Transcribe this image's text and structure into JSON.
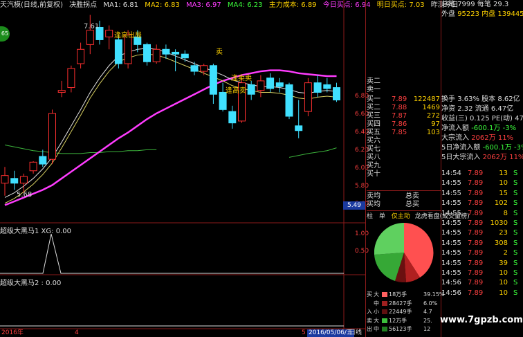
{
  "header": {
    "stock_name": "天汽模(日线,前复权)",
    "indicator": "决胜拐点",
    "ma1": "MA1: 6.81",
    "ma2": "MA2: 6.83",
    "ma3": "MA3: 6.97",
    "ma4": "MA4: 6.23",
    "cost": "主力成本: 6.89",
    "buy_today": "今日买点: 6.94",
    "buy_tomorrow": "明日买点: 7.03",
    "rest": "昨测今日"
  },
  "annotations": {
    "peak": "7.61",
    "low": "5.68",
    "exit1": "逢高出局",
    "sell1": "卖",
    "sell2": "逢高卖",
    "sell3": "逢卖卖",
    "small": "卖"
  },
  "price_axis": [
    "6.80",
    "6.60",
    "6.40",
    "6.20",
    "6.00",
    "5.80",
    "5.60"
  ],
  "current_price": "5.49",
  "sub1": {
    "title": "超级大黑马1 XG: 0.00",
    "axis": [
      "1.00",
      "0.50"
    ]
  },
  "sub2": {
    "title": "超级大黑马2 : 0.00"
  },
  "bottom": {
    "left": "2016年",
    "mid": "4",
    "mid2": "5",
    "date": "2016/05/06/五",
    "period": "日线"
  },
  "orderbook": {
    "asks": [
      {
        "label": "卖二",
        "price": "",
        "vol": ""
      },
      {
        "label": "卖一",
        "price": "",
        "vol": ""
      }
    ],
    "bids": [
      {
        "label": "买一",
        "price": "7.89",
        "vol": "122487"
      },
      {
        "label": "买二",
        "price": "7.88",
        "vol": "1469"
      },
      {
        "label": "买三",
        "price": "7.87",
        "vol": "272"
      },
      {
        "label": "买四",
        "price": "7.86",
        "vol": "97"
      },
      {
        "label": "买五",
        "price": "7.85",
        "vol": "103"
      },
      {
        "label": "买六",
        "price": "",
        "vol": ""
      },
      {
        "label": "买七",
        "price": "",
        "vol": ""
      },
      {
        "label": "买八",
        "price": "",
        "vol": ""
      },
      {
        "label": "买九",
        "price": "",
        "vol": ""
      },
      {
        "label": "买十",
        "price": "",
        "vol": ""
      }
    ],
    "avg_sell": "卖均",
    "total_sell": "总卖",
    "avg_buy": "买均",
    "total_buy": "总买"
  },
  "stats": [
    {
      "k": "总笔",
      "v": "7999 每笔",
      "v2": "29.3",
      "color": "#ddd"
    },
    {
      "k": "外盘",
      "v": "95223 内盘",
      "v2": "139445",
      "color": "#ffd200"
    },
    {
      "k": "换手",
      "v": "3.63% 股本",
      "v2": "8.62亿",
      "color": "#ddd"
    },
    {
      "k": "净资",
      "v": "2.32 流通",
      "v2": "6.47亿",
      "color": "#ddd"
    },
    {
      "k": "收益(三)",
      "v": "0.125 PE(动)",
      "v2": "47.4",
      "color": "#ddd"
    },
    {
      "k": "净流入额",
      "v": "-600.1万",
      "v2": "-3%",
      "color": "#3cff3c"
    },
    {
      "k": "大宗流入",
      "v": "2062万",
      "v2": "11%",
      "color": "#ff4040"
    },
    {
      "k": "5日净流入额",
      "v": "-600.1万",
      "v2": "-3%",
      "color": "#3cff3c"
    },
    {
      "k": "5日大宗流入",
      "v": "2062万",
      "v2": "11%",
      "color": "#ff4040"
    }
  ],
  "ticks": [
    {
      "t": "14:54",
      "p": "7.89",
      "v": "13",
      "s": "S"
    },
    {
      "t": "14:55",
      "p": "7.89",
      "v": "10",
      "s": "S"
    },
    {
      "t": "14:55",
      "p": "7.89",
      "v": "15",
      "s": "S"
    },
    {
      "t": "14:55",
      "p": "7.89",
      "v": "102",
      "s": "S"
    },
    {
      "t": "14:55",
      "p": "7.89",
      "v": "8",
      "s": "S"
    },
    {
      "t": "14:55",
      "p": "7.89",
      "v": "1030",
      "s": "S"
    },
    {
      "t": "14:55",
      "p": "7.89",
      "v": "23",
      "s": "S"
    },
    {
      "t": "14:55",
      "p": "7.89",
      "v": "308",
      "s": "S"
    },
    {
      "t": "14:55",
      "p": "7.89",
      "v": "2",
      "s": "S"
    },
    {
      "t": "14:55",
      "p": "7.89",
      "v": "39",
      "s": "S"
    },
    {
      "t": "14:55",
      "p": "7.89",
      "v": "10",
      "s": "S"
    },
    {
      "t": "14:56",
      "p": "7.89",
      "v": "10",
      "s": "S"
    },
    {
      "t": "14:56",
      "p": "7.89",
      "v": "10",
      "s": "S"
    }
  ],
  "tabs": [
    "柱",
    "单",
    "仅主动",
    "龙虎看盘(成交量榜)"
  ],
  "dist": [
    {
      "side": "买",
      "k": "大",
      "v": "18万手",
      "pct": "39.15%",
      "color": "#ff6060"
    },
    {
      "side": "",
      "k": "中",
      "v": "28427手",
      "pct": "6.0%",
      "color": "#a02020"
    },
    {
      "side": "入",
      "k": "小",
      "v": "22449手",
      "pct": "4.7",
      "color": "#601010"
    },
    {
      "side": "卖",
      "k": "大",
      "v": "12万手",
      "pct": "25.",
      "color": "#3cbf3c"
    },
    {
      "side": "出",
      "k": "中",
      "v": "56123手",
      "pct": "12",
      "color": "#208020"
    }
  ],
  "watermark": "www.7gpzb.com",
  "logo": "65",
  "colors": {
    "up": "#ff3030",
    "down": "#40e0ff",
    "ma_slow": "#ff3cff",
    "ma_mid": "#3cb43c",
    "ma_fast": "#e0e0e0",
    "ma_yellow": "#d8d060"
  },
  "chart_data": {
    "type": "candlestick",
    "candles": [
      {
        "o": 5.85,
        "h": 6.02,
        "l": 5.72,
        "c": 5.93
      },
      {
        "o": 5.9,
        "h": 5.98,
        "l": 5.78,
        "c": 5.85
      },
      {
        "o": 5.85,
        "h": 5.95,
        "l": 5.75,
        "c": 5.92
      },
      {
        "o": 5.98,
        "h": 6.08,
        "l": 5.95,
        "c": 6.07
      },
      {
        "o": 6.13,
        "h": 6.2,
        "l": 6.02,
        "c": 6.05
      },
      {
        "o": 6.1,
        "h": 6.62,
        "l": 6.05,
        "c": 6.58
      },
      {
        "o": 6.8,
        "h": 6.92,
        "l": 6.75,
        "c": 6.82
      },
      {
        "o": 6.85,
        "h": 7.08,
        "l": 6.8,
        "c": 7.05
      },
      {
        "o": 7.1,
        "h": 7.32,
        "l": 7.05,
        "c": 7.25
      },
      {
        "o": 7.3,
        "h": 7.61,
        "l": 7.2,
        "c": 7.45
      },
      {
        "o": 7.48,
        "h": 7.55,
        "l": 7.3,
        "c": 7.35
      },
      {
        "o": 7.38,
        "h": 7.5,
        "l": 7.25,
        "c": 7.45
      },
      {
        "o": 7.35,
        "h": 7.4,
        "l": 7.05,
        "c": 7.1
      },
      {
        "o": 7.1,
        "h": 7.45,
        "l": 7.05,
        "c": 7.4
      },
      {
        "o": 7.38,
        "h": 7.45,
        "l": 7.22,
        "c": 7.3
      },
      {
        "o": 7.3,
        "h": 7.32,
        "l": 7.08,
        "c": 7.12
      },
      {
        "o": 7.12,
        "h": 7.3,
        "l": 7.1,
        "c": 7.25
      },
      {
        "o": 7.25,
        "h": 7.3,
        "l": 7.15,
        "c": 7.2
      },
      {
        "o": 7.22,
        "h": 7.25,
        "l": 7.02,
        "c": 7.2
      },
      {
        "o": 7.2,
        "h": 7.24,
        "l": 7.12,
        "c": 7.16
      },
      {
        "o": 7.08,
        "h": 7.12,
        "l": 6.98,
        "c": 7.02
      },
      {
        "o": 7.02,
        "h": 7.1,
        "l": 6.98,
        "c": 7.08
      },
      {
        "o": 7.08,
        "h": 7.1,
        "l": 6.68,
        "c": 6.78
      },
      {
        "o": 6.8,
        "h": 6.9,
        "l": 6.6,
        "c": 6.62
      },
      {
        "o": 6.6,
        "h": 6.66,
        "l": 6.42,
        "c": 6.48
      },
      {
        "o": 6.5,
        "h": 6.95,
        "l": 6.48,
        "c": 6.9
      },
      {
        "o": 6.88,
        "h": 6.92,
        "l": 6.72,
        "c": 6.78
      },
      {
        "o": 6.82,
        "h": 6.98,
        "l": 6.75,
        "c": 6.92
      },
      {
        "o": 6.95,
        "h": 7.0,
        "l": 6.8,
        "c": 6.84
      },
      {
        "o": 6.9,
        "h": 6.95,
        "l": 6.8,
        "c": 6.86
      },
      {
        "o": 6.88,
        "h": 6.9,
        "l": 6.52,
        "c": 6.55
      },
      {
        "o": 6.45,
        "h": 6.72,
        "l": 6.32,
        "c": 6.4
      },
      {
        "o": 6.6,
        "h": 6.95,
        "l": 6.55,
        "c": 6.9
      },
      {
        "o": 6.9,
        "h": 6.98,
        "l": 6.75,
        "c": 6.8
      },
      {
        "o": 6.88,
        "h": 6.95,
        "l": 6.8,
        "c": 6.84
      },
      {
        "o": 6.85,
        "h": 6.9,
        "l": 6.7,
        "c": 6.72
      }
    ],
    "ma_slow": [
      5.62,
      5.66,
      5.7,
      5.74,
      5.78,
      5.83,
      5.9,
      5.97,
      6.04,
      6.11,
      6.18,
      6.25,
      6.32,
      6.38,
      6.45,
      6.52,
      6.58,
      6.63,
      6.68,
      6.73,
      6.78,
      6.83,
      6.88,
      6.92,
      6.95,
      6.98,
      7.0,
      7.02,
      7.03,
      7.03,
      7.02,
      7.0,
      6.99,
      6.98,
      6.97,
      6.97
    ],
    "ma_fast": [
      5.7,
      5.75,
      5.82,
      5.9,
      6.0,
      6.12,
      6.28,
      6.45,
      6.62,
      6.8,
      6.95,
      7.08,
      7.18,
      7.22,
      7.25,
      7.26,
      7.25,
      7.22,
      7.18,
      7.14,
      7.1,
      7.06,
      7.02,
      6.98,
      6.93,
      6.9,
      6.88,
      6.86,
      6.86,
      6.85,
      6.83,
      6.8,
      6.79,
      6.81,
      6.82,
      6.81
    ],
    "ma_mid": [
      6.25,
      6.23,
      6.21,
      6.19,
      6.18,
      6.17,
      6.16,
      6.16,
      6.16,
      6.17,
      6.17,
      6.18,
      6.18,
      6.19,
      6.19,
      6.2,
      6.2
    ]
  }
}
